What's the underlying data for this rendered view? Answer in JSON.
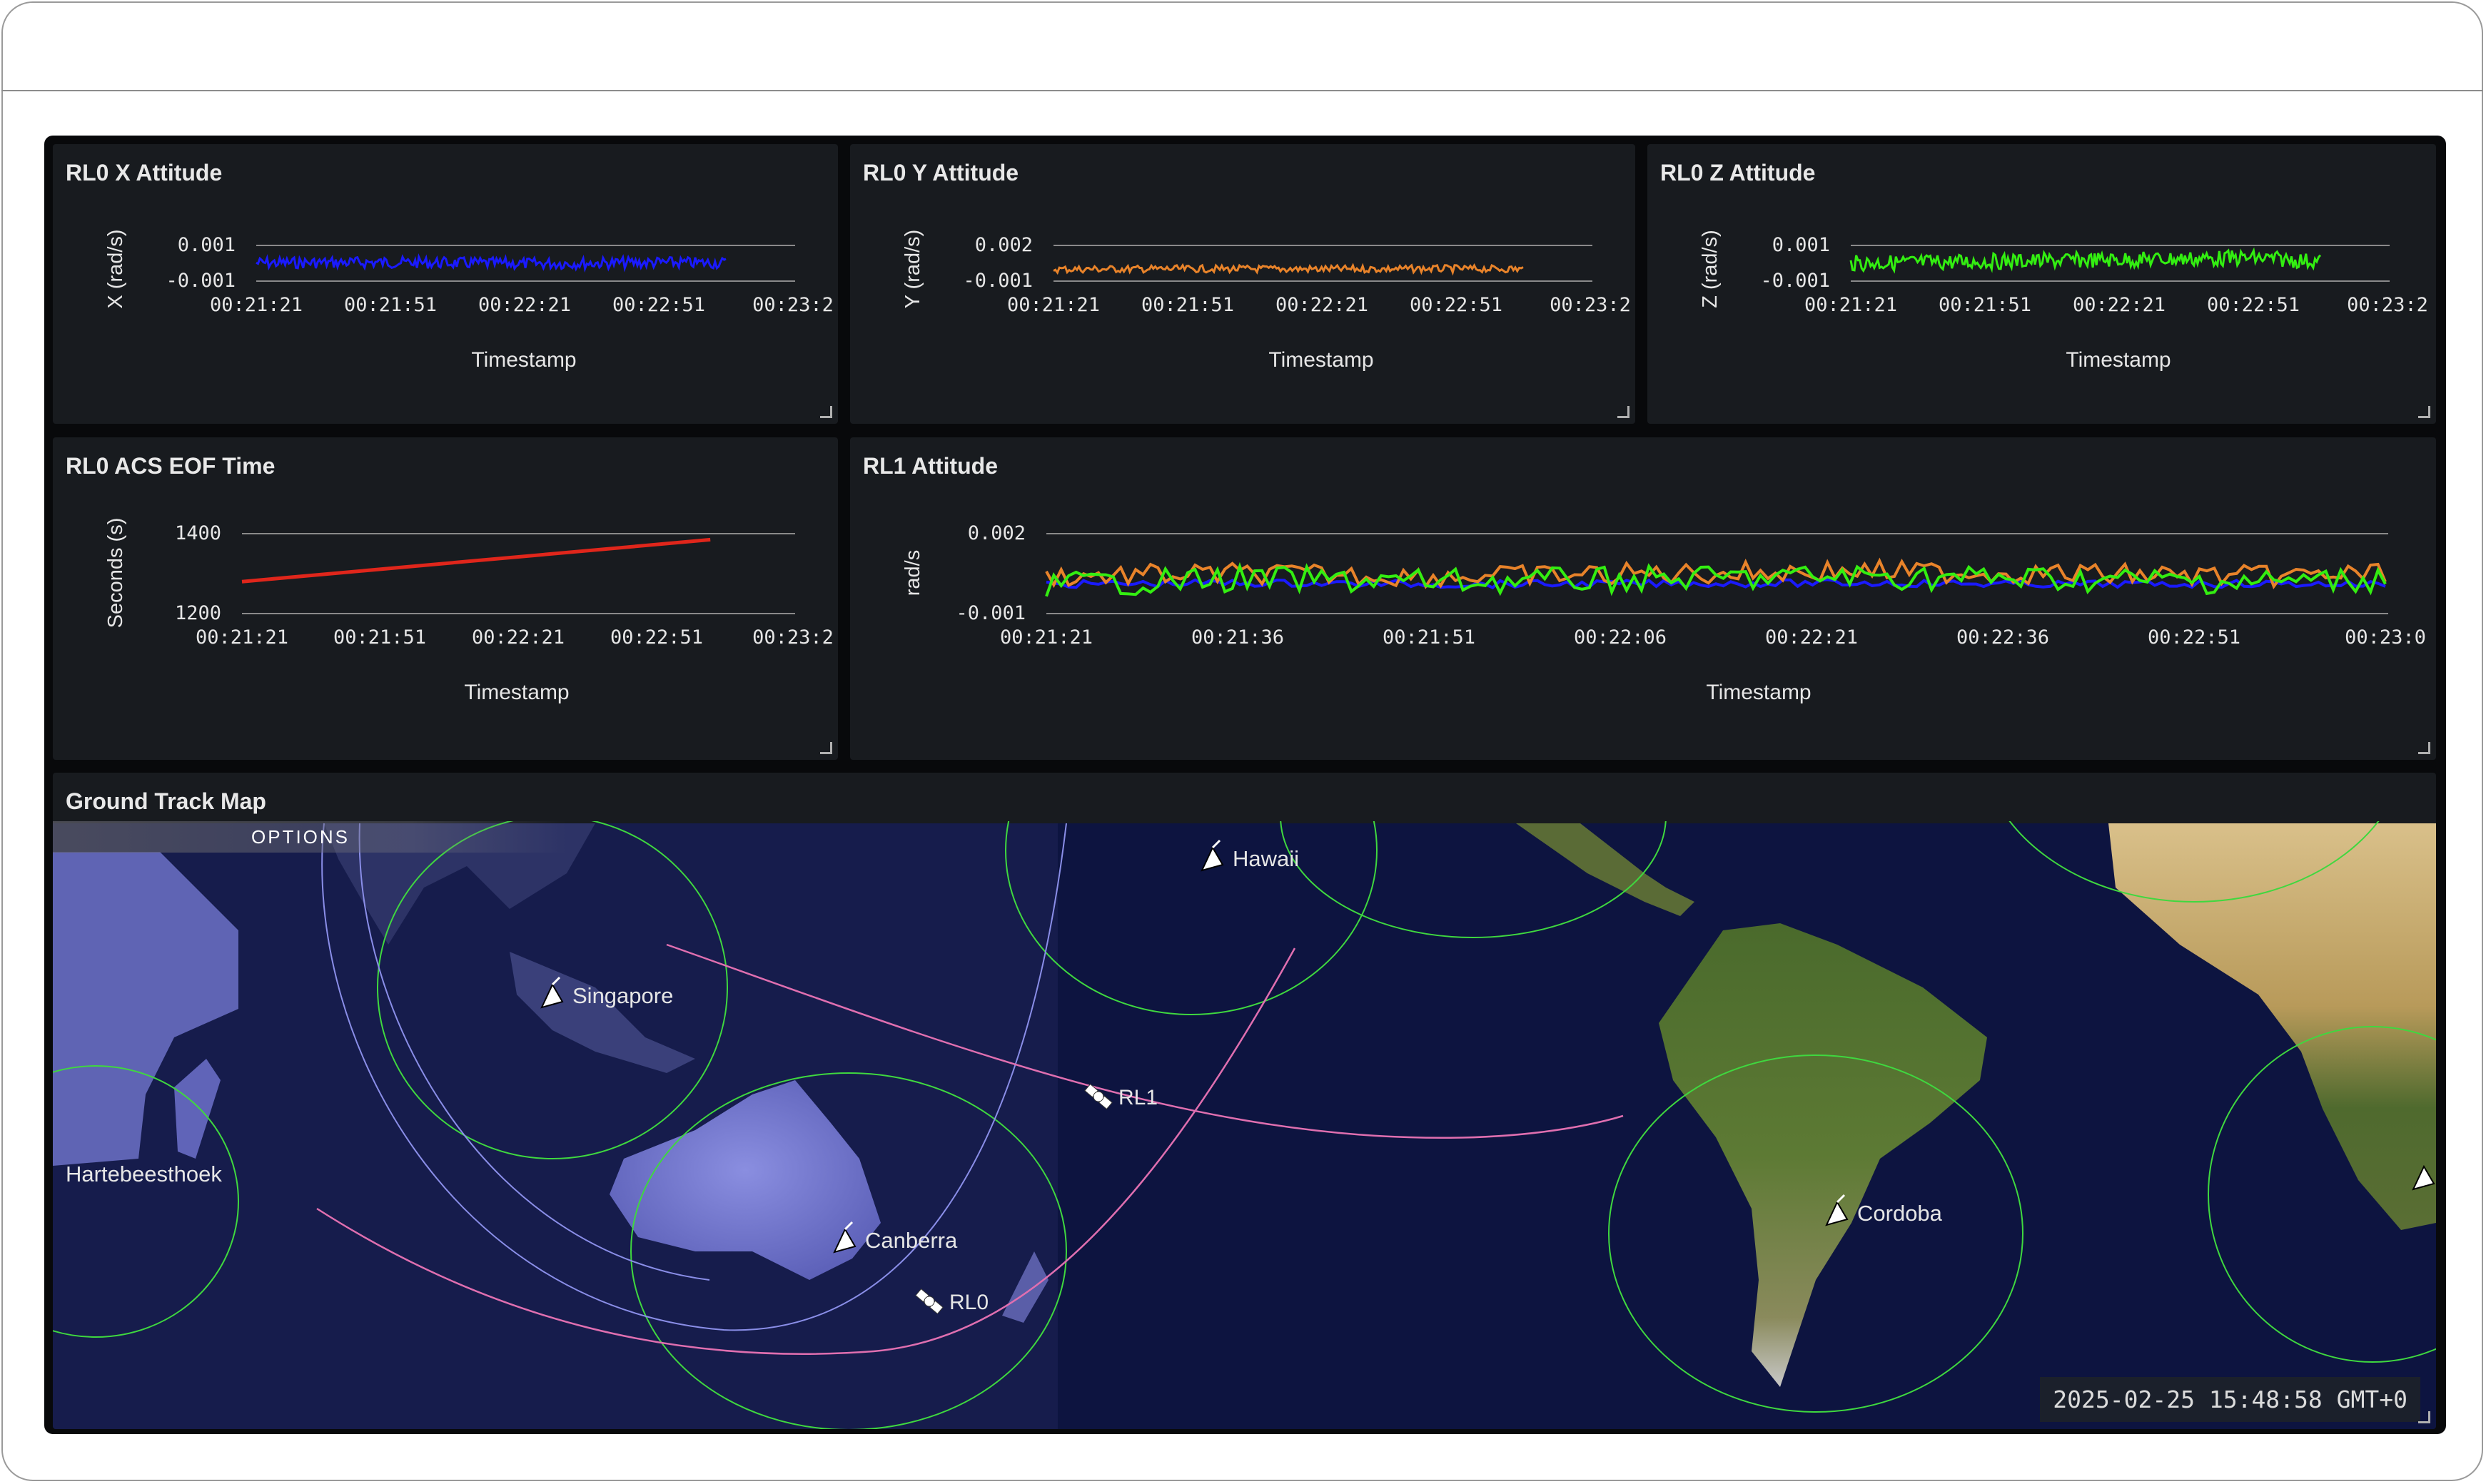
{
  "panels": {
    "x_attitude": {
      "title": "RL0 X Attitude",
      "ylabel": "X (rad/s)",
      "xlabel": "Timestamp",
      "yticks": [
        "0.001",
        "-0.001"
      ],
      "xticks": [
        "00:21:21",
        "00:21:51",
        "00:22:21",
        "00:22:51",
        "00:23:2"
      ]
    },
    "y_attitude": {
      "title": "RL0 Y Attitude",
      "ylabel": "Y (rad/s)",
      "xlabel": "Timestamp",
      "yticks": [
        "0.002",
        "-0.001"
      ],
      "xticks": [
        "00:21:21",
        "00:21:51",
        "00:22:21",
        "00:22:51",
        "00:23:2"
      ]
    },
    "z_attitude": {
      "title": "RL0 Z Attitude",
      "ylabel": "Z (rad/s)",
      "xlabel": "Timestamp",
      "yticks": [
        "0.001",
        "-0.001"
      ],
      "xticks": [
        "00:21:21",
        "00:21:51",
        "00:22:21",
        "00:22:51",
        "00:23:2"
      ]
    },
    "eof_time": {
      "title": "RL0 ACS EOF Time",
      "ylabel": "Seconds (s)",
      "xlabel": "Timestamp",
      "yticks": [
        "1400",
        "1200"
      ],
      "xticks": [
        "00:21:21",
        "00:21:51",
        "00:22:21",
        "00:22:51",
        "00:23:2"
      ]
    },
    "rl1_attitude": {
      "title": "RL1 Attitude",
      "ylabel": "rad/s",
      "xlabel": "Timestamp",
      "yticks": [
        "0.002",
        "-0.001"
      ],
      "xticks": [
        "00:21:21",
        "00:21:36",
        "00:21:51",
        "00:22:06",
        "00:22:21",
        "00:22:36",
        "00:22:51",
        "00:23:0"
      ]
    }
  },
  "map": {
    "title": "Ground Track Map",
    "options_label": "OPTIONS",
    "timestamp": "2025-02-25 15:48:58 GMT+0",
    "stations": [
      "Hawaii",
      "Singapore",
      "Hartebeesthoek",
      "Canberra",
      "Cordoba"
    ],
    "satellites": [
      "RL1",
      "RL0"
    ]
  },
  "colors": {
    "x_series": "#1a1aff",
    "y_series": "#e8832a",
    "z_series": "#33ee11",
    "eof_series": "#e0261b",
    "label_yellow": "#e8c21a",
    "coverage": "#3fd83f",
    "track": "#e06fb0"
  },
  "chart_data": [
    {
      "type": "line",
      "title": "RL0 X Attitude",
      "xlabel": "Timestamp",
      "ylabel": "X (rad/s)",
      "ylim": [
        -0.001,
        0.001
      ],
      "xlim": [
        "00:21:21",
        "00:23:21"
      ],
      "x": [
        "00:21:21",
        "00:21:51",
        "00:22:21",
        "00:22:51",
        "00:23:06"
      ],
      "series": [
        {
          "values": [
            2e-05,
            5e-05,
            -2e-05,
            4e-05,
            1e-05
          ]
        }
      ]
    },
    {
      "type": "line",
      "title": "RL0 Y Attitude",
      "xlabel": "Timestamp",
      "ylabel": "Y (rad/s)",
      "ylim": [
        -0.001,
        0.002
      ],
      "xlim": [
        "00:21:21",
        "00:23:21"
      ],
      "x": [
        "00:21:21",
        "00:21:51",
        "00:22:21",
        "00:22:51",
        "00:23:06"
      ],
      "series": [
        {
          "values": [
            0.0,
            3e-05,
            1e-05,
            4e-05,
            2e-05
          ]
        }
      ]
    },
    {
      "type": "line",
      "title": "RL0 Z Attitude",
      "xlabel": "Timestamp",
      "ylabel": "Z (rad/s)",
      "ylim": [
        -0.001,
        0.001
      ],
      "xlim": [
        "00:21:21",
        "00:23:21"
      ],
      "x": [
        "00:21:21",
        "00:21:51",
        "00:22:21",
        "00:22:51",
        "00:23:06"
      ],
      "series": [
        {
          "values": [
            0.0,
            0.0001,
            0.0002,
            0.0003,
            0.0001
          ]
        }
      ]
    },
    {
      "type": "line",
      "title": "RL0 ACS EOF Time",
      "xlabel": "Timestamp",
      "ylabel": "Seconds (s)",
      "ylim": [
        1200,
        1400
      ],
      "xlim": [
        "00:21:21",
        "00:23:21"
      ],
      "x": [
        "00:21:21",
        "00:23:03"
      ],
      "series": [
        {
          "values": [
            1280,
            1385
          ]
        }
      ]
    },
    {
      "type": "line",
      "title": "RL1 Attitude",
      "xlabel": "Timestamp",
      "ylabel": "rad/s",
      "ylim": [
        -0.001,
        0.002
      ],
      "xlim": [
        "00:21:21",
        "00:23:00"
      ],
      "x": [
        "00:21:21",
        "00:21:36",
        "00:21:51",
        "00:22:06",
        "00:22:21",
        "00:22:36",
        "00:22:51",
        "00:23:00"
      ],
      "series": [
        {
          "values": [
            0.0001,
            0.00015,
            0.0001,
            0.00012,
            0.00015,
            0.0001,
            0.00012,
            0.0001
          ]
        },
        {
          "values": [
            0.0004,
            0.0005,
            0.0004,
            0.0005,
            0.0006,
            0.0005,
            0.0004,
            0.0005
          ]
        },
        {
          "values": [
            0.0001,
            0.0003,
            0.0002,
            0.0003,
            0.0004,
            0.0003,
            0.0002,
            0.0003
          ]
        }
      ]
    }
  ]
}
